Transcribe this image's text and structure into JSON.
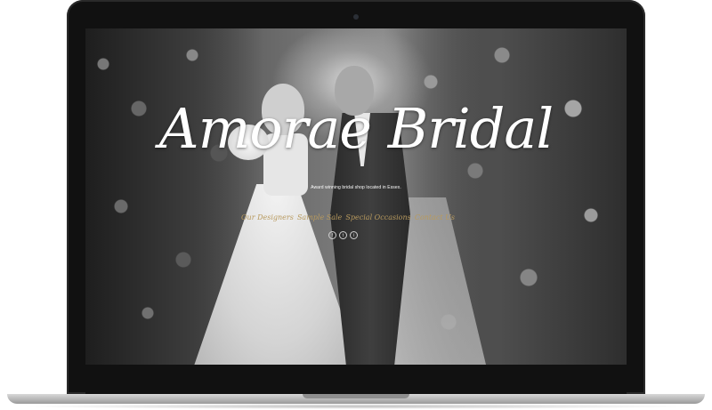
{
  "site": {
    "brand": "Amorae Bridal",
    "tagline": "Award winning bridal shop located in Essex."
  },
  "nav": {
    "items": [
      {
        "label": "Our Designers"
      },
      {
        "label": "Sample Sale"
      },
      {
        "label": "Special Occasions"
      },
      {
        "label": "Contact Us"
      }
    ]
  },
  "social": [
    {
      "icon": "facebook-icon",
      "glyph": "f"
    },
    {
      "icon": "twitter-icon",
      "glyph": "t"
    },
    {
      "icon": "instagram-icon",
      "glyph": "i"
    }
  ],
  "colors": {
    "nav_gold": "#b89a5e",
    "brand_text": "#ffffff",
    "device_black": "#111111"
  }
}
